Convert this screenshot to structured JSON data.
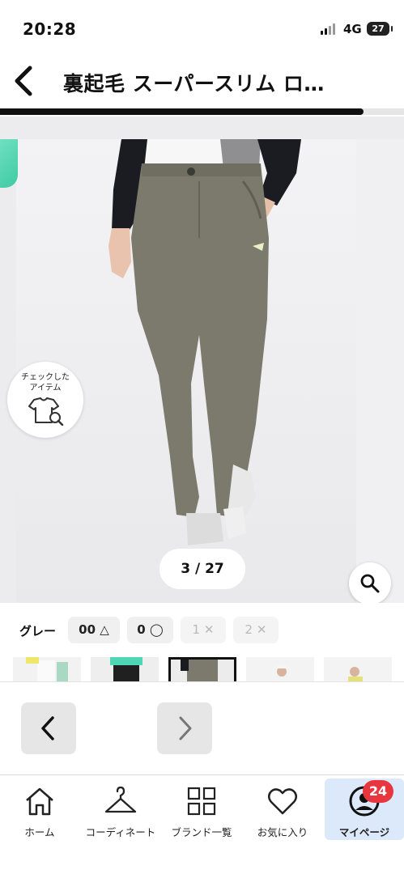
{
  "status_bar": {
    "time": "20:28",
    "network": "4G",
    "battery": "27"
  },
  "header": {
    "title": "裏起毛 スーパースリム ロ…",
    "gallery_progress": 0.9
  },
  "gallery": {
    "check_items_label": "チェックした\nアイテム",
    "counter": "3 / 27",
    "current": 3,
    "total": 27
  },
  "variants": {
    "color_name": "グレー",
    "sizes": [
      {
        "label": "00 △",
        "available": true
      },
      {
        "label": "0 ◯",
        "available": true
      },
      {
        "label": "1 ✕",
        "available": false
      },
      {
        "label": "2 ✕",
        "available": false
      }
    ]
  },
  "tabbar": {
    "items": [
      {
        "label": "ホーム",
        "icon": "home-icon"
      },
      {
        "label": "コーディネート",
        "icon": "hanger-icon"
      },
      {
        "label": "ブランド一覧",
        "icon": "grid-icon"
      },
      {
        "label": "お気に入り",
        "icon": "heart-icon"
      },
      {
        "label": "マイページ",
        "icon": "user-icon"
      }
    ],
    "active_index": 4,
    "mypage_badge": "24"
  },
  "colors": {
    "accent_blue": "#dbe9fb",
    "badge_red": "#e8363f",
    "pants_olive": "#7b7a6c"
  }
}
